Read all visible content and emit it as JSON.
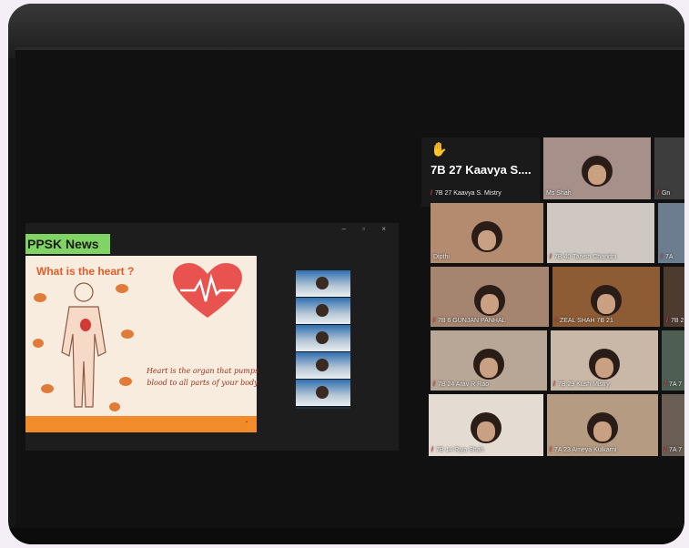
{
  "presentation": {
    "news_label": "PPSK News",
    "slide_title": "What is the heart ?",
    "slide_text": "Heart is the organ that pumps blood to all parts of your body",
    "window_controls": "– ▫ ×"
  },
  "participants": {
    "featured": {
      "display_name": "7B 27 Kaavya S....",
      "label": "7B 27 Kaavya S. Mistry",
      "hand_raised": true
    },
    "tiles": [
      {
        "label": "Ms Shah",
        "muted": false,
        "color": "#a8908a"
      },
      {
        "label": "Dipthi",
        "muted": false,
        "color": "#b38c70"
      },
      {
        "label": "7B 40 Tanish Chandni",
        "muted": true,
        "color": "#cfc8c0"
      },
      {
        "label": "7B 6 GUNJAN PANHAL",
        "muted": true,
        "color": "#a58570"
      },
      {
        "label": "ZEAL SHAH 7B 21",
        "muted": true,
        "color": "#8e5c34"
      },
      {
        "label": "7B 24 Arav R Rao",
        "muted": true,
        "color": "#b8a796"
      },
      {
        "label": "7B 29 Kush Mistry",
        "muted": true,
        "color": "#c9b8a8"
      },
      {
        "label": "7B 14 Riya Shah",
        "muted": true,
        "color": "#e4dcd2"
      },
      {
        "label": "7A 23 Ameya Kulkarni",
        "muted": true,
        "color": "#b59b82"
      },
      {
        "label": "Gn",
        "muted": true,
        "color": "#3d3d3d"
      },
      {
        "label": "7A",
        "muted": true,
        "color": "#6a7e90"
      },
      {
        "label": "7B 2",
        "muted": true,
        "color": "#4d3b30"
      },
      {
        "label": "7A 7",
        "muted": true,
        "color": "#4f5e52"
      },
      {
        "label": "7A 7",
        "muted": true,
        "color": "#6a5d54"
      }
    ]
  },
  "colors": {
    "news_green": "#7fd463",
    "slide_orange": "#f28b2a",
    "heart_red": "#e9534f",
    "muted_red": "#e24343",
    "hand_yellow": "#f4c430"
  }
}
